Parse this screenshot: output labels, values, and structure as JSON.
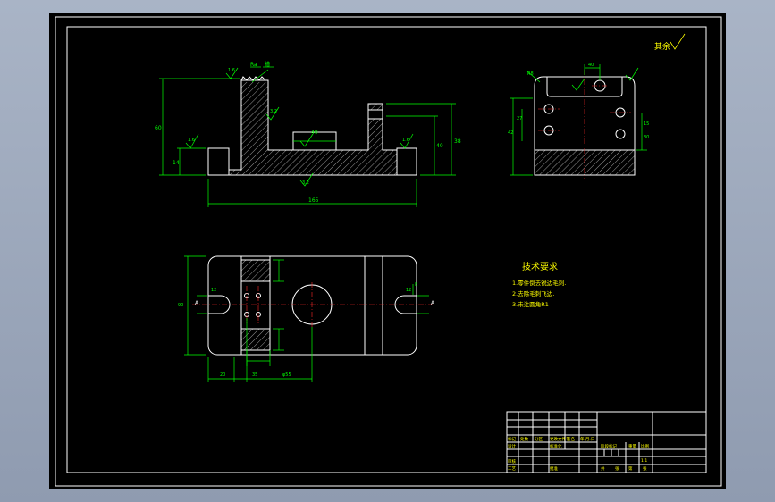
{
  "drawing": {
    "roughness_note": "其余",
    "tech_req": {
      "title": "技术要求",
      "items": [
        "1.零件倒去锐边毛刺.",
        "2.去除毛刺飞边.",
        "3.未注圆角R1"
      ]
    },
    "front_dims": {
      "overall_width": "165",
      "overall_height": "60",
      "top_callout_a": "Ra",
      "top_callout_b": "槽",
      "r1": "1.6",
      "r2": "1.6",
      "r3": "1.6",
      "r4": "3.2",
      "r5": "3.2",
      "left_h": "14",
      "right_h1": "38",
      "right_h2": "40",
      "slot_w": "40"
    },
    "side_dims": {
      "top_w": "40",
      "h1": "27",
      "h2": "15",
      "h3": "30",
      "h4": "42",
      "corner": "R8"
    },
    "plan_dims": {
      "d1": "20",
      "d2": "35",
      "d3": "φ55",
      "h_left": "90",
      "slot": "12",
      "slot_r": "12",
      "a_left": "A",
      "a_right": "A",
      "off": "8"
    },
    "title_block": {
      "cells": [
        "标记",
        "处数",
        "分区",
        "更改文件号",
        "签名",
        "年.月.日",
        "设计",
        "标准化",
        "审核",
        "工艺",
        "批准",
        "阶段标记",
        "重量",
        "比例",
        "共",
        "张",
        "第",
        "张",
        "1:1"
      ]
    }
  }
}
